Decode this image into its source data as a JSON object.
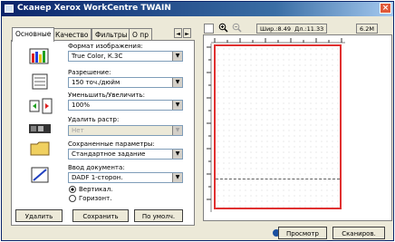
{
  "window": {
    "title": "Сканер Xerox WorkCentre TWAIN",
    "close": "×"
  },
  "tabs": [
    {
      "label": "Основные"
    },
    {
      "label": "Качество"
    },
    {
      "label": "Фильтры"
    },
    {
      "label": "О пр"
    }
  ],
  "tab_arrows": {
    "left": "◄",
    "right": "►"
  },
  "fields": {
    "image_format": {
      "label": "Формат изображения:",
      "value": "True Color, К.3C"
    },
    "resolution": {
      "label": "Разрешение:",
      "value": "150 точ./дюйм"
    },
    "scale": {
      "label": "Уменьшить/Увеличить:",
      "value": "100%"
    },
    "descreen": {
      "label": "Удалить растр:",
      "value": "Нет"
    },
    "saved_params": {
      "label": "Сохраненные параметры:",
      "value": "Стандартное задание"
    },
    "doc_input": {
      "label": "Ввод документа:",
      "value": "DADF 1-сторон."
    }
  },
  "orientation": {
    "options": [
      {
        "label": "Вертикал.",
        "selected": true
      },
      {
        "label": "Горизонт.",
        "selected": false
      }
    ]
  },
  "buttons": {
    "delete": "Удалить",
    "save": "Сохранить",
    "default": "По умолч.",
    "preview": "Просмотр",
    "scan": "Сканиров."
  },
  "toolbar": {
    "width_readout": "Шир.:8.49",
    "length_readout": "Дл.:11.33",
    "size_readout": "6.2M"
  },
  "dropdown_glyph": "▼"
}
